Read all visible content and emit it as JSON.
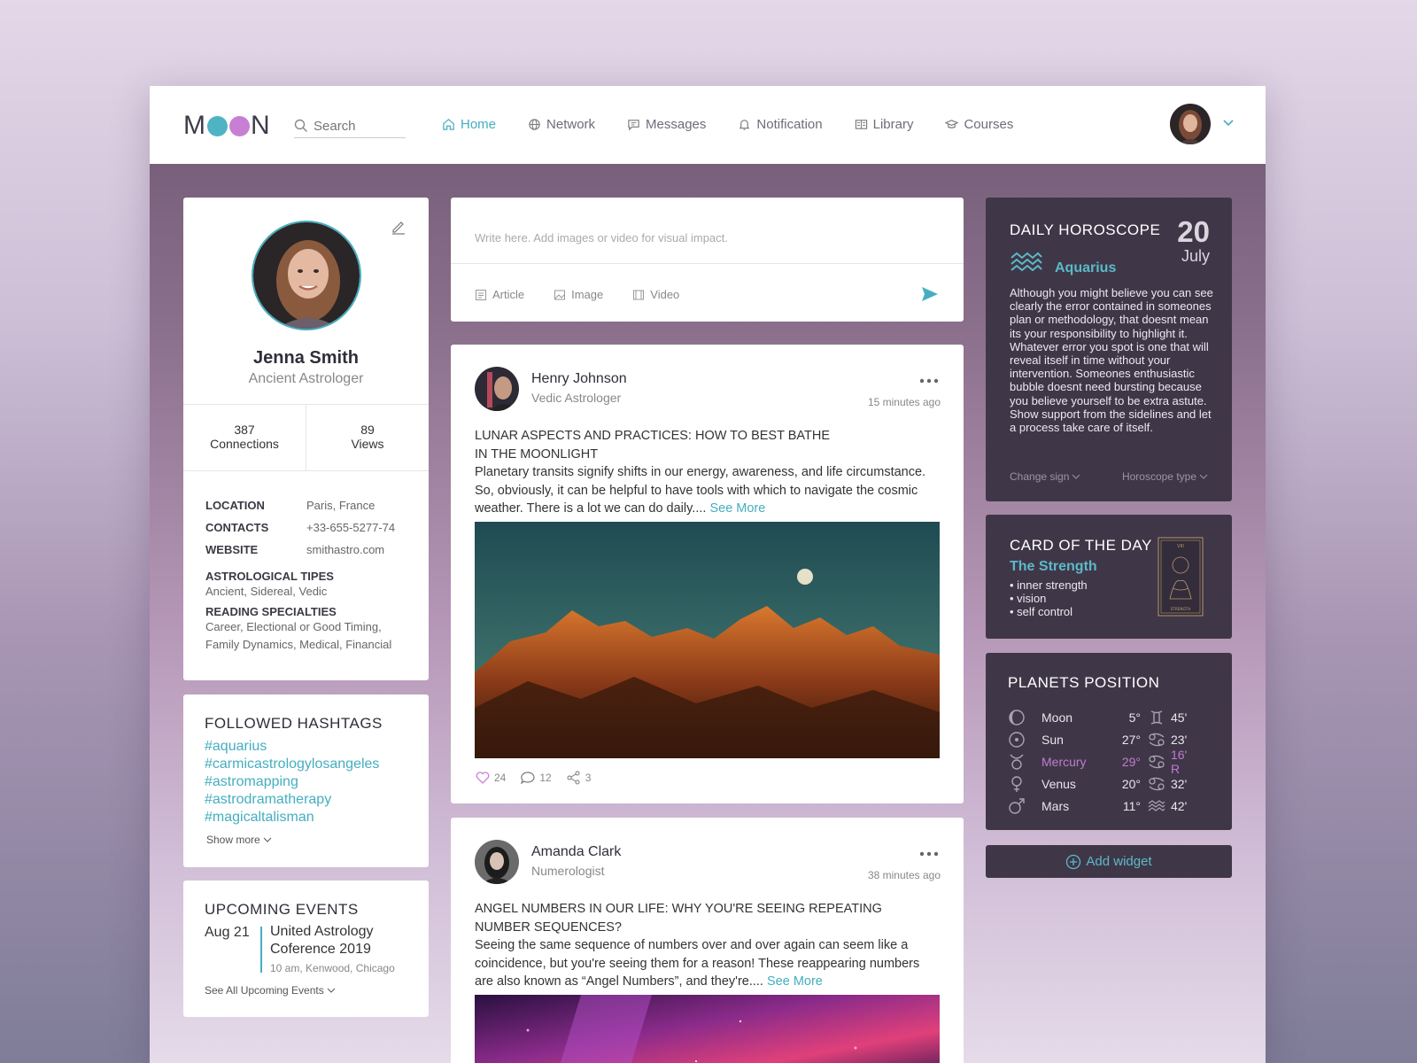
{
  "brand": {
    "logo_left": "M",
    "logo_right": "N",
    "dot1_color": "#4fb3c4",
    "dot2_color": "#c77fd3"
  },
  "search": {
    "placeholder": "Search"
  },
  "nav": [
    {
      "label": "Home",
      "icon": "home-icon",
      "active": true
    },
    {
      "label": "Network",
      "icon": "globe-icon"
    },
    {
      "label": "Messages",
      "icon": "message-icon"
    },
    {
      "label": "Notification",
      "icon": "bell-icon"
    },
    {
      "label": "Library",
      "icon": "book-icon"
    },
    {
      "label": "Courses",
      "icon": "graduation-cap-icon"
    }
  ],
  "colors": {
    "accent": "#45aec0",
    "highlight": "#c27ad0",
    "dark_card": "#3f3748"
  },
  "profile": {
    "name": "Jenna Smith",
    "role": "Ancient Astrologer",
    "connections": "387",
    "connections_label": "Connections",
    "views": "89",
    "views_label": "Views",
    "location_label": "LOCATION",
    "location": "Paris, France",
    "contacts_label": "CONTACTS",
    "contacts": "+33-655-5277-74",
    "website_label": "WEBSITE",
    "website": "smithastro.com",
    "tipes_label": "ASTROLOGICAL TIPES",
    "tipes": "Ancient, Sidereal, Vedic",
    "spec_label": "READING SPECIALTIES",
    "spec": "Career, Electional or Good Timing, Family Dynamics, Medical, Financial"
  },
  "hashtags": {
    "title": "FOLLOWED HASHTAGS",
    "items": [
      "#aquarius",
      "#carmicastrologylosangeles",
      "#astromapping",
      "#astrodramatherapy",
      "#magicaltalisman"
    ],
    "more": "Show more"
  },
  "events": {
    "title": "UPCOMING EVENTS",
    "date": "Aug 21",
    "name": "United Astrology Coference 2019",
    "detail": "10 am, Kenwood, Chicago",
    "all": "See All Upcoming Events"
  },
  "composer": {
    "placeholder": "Write here. Add images or video for visual impact.",
    "article": "Article",
    "image": "Image",
    "video": "Video"
  },
  "posts": [
    {
      "author": "Henry Johnson",
      "role": "Vedic Astrologer",
      "time": "15 minutes ago",
      "title1": "LUNAR ASPECTS AND PRACTICES: HOW TO BEST BATHE",
      "title2": "IN THE MOONLIGHT",
      "text": "Planetary transits signify shifts in our energy, awareness, and life circumstance. So, obviously, it can be helpful to have tools with which to navigate the cosmic weather. There is a lot we can do daily.... ",
      "see_more": "See More",
      "likes": "24",
      "comments": "12",
      "shares": "3"
    },
    {
      "author": "Amanda Clark",
      "role": "Numerologist",
      "time": "38 minutes ago",
      "title1": "ANGEL NUMBERS IN OUR LIFE: WHY YOU'RE SEEING REPEATING",
      "title2": "NUMBER SEQUENCES?",
      "text": "Seeing the same sequence of numbers over and over again can seem like a coincidence, but you're seeing them for a reason! These reappearing numbers are also known as “Angel Numbers”, and they're.... ",
      "see_more": "See More"
    }
  ],
  "horoscope": {
    "title": "DAILY HOROSCOPE",
    "day": "20",
    "month": "July",
    "sign": "Aquarius",
    "text": "Although you might believe you can see clearly the error contained in someones plan or methodology, that doesnt mean its your responsibility to highlight it. Whatever error you spot is one that will reveal itself in time without your intervention. Someones enthusiastic bubble doesnt need bursting because you believe yourself to be extra astute. Show support from the sidelines and let a process take care of itself.",
    "change_sign": "Change sign",
    "type": "Horoscope type"
  },
  "card_of_day": {
    "title": "CARD OF THE DAY",
    "name": "The Strength",
    "items": [
      "• inner strength",
      "• vision",
      "• self control"
    ],
    "tarot_top": "VIII",
    "tarot_bottom": "STRENGTH"
  },
  "planets": {
    "title": "PLANETS POSITION",
    "rows": [
      {
        "name": "Moon",
        "deg": "5°",
        "min": "45'",
        "icon": "moon-icon",
        "sign_icon": "gemini-icon"
      },
      {
        "name": "Sun",
        "deg": "27°",
        "min": "23'",
        "icon": "sun-icon",
        "sign_icon": "cancer-icon"
      },
      {
        "name": "Mercury",
        "deg": "29°",
        "min": "16' R",
        "icon": "taurus-icon",
        "sign_icon": "cancer-icon",
        "highlight": true
      },
      {
        "name": "Venus",
        "deg": "20°",
        "min": "32'",
        "icon": "venus-icon",
        "sign_icon": "cancer-icon"
      },
      {
        "name": "Mars",
        "deg": "11°",
        "min": "42'",
        "icon": "mars-icon",
        "sign_icon": "aquarius-icon"
      }
    ]
  },
  "add_widget": "Add widget"
}
